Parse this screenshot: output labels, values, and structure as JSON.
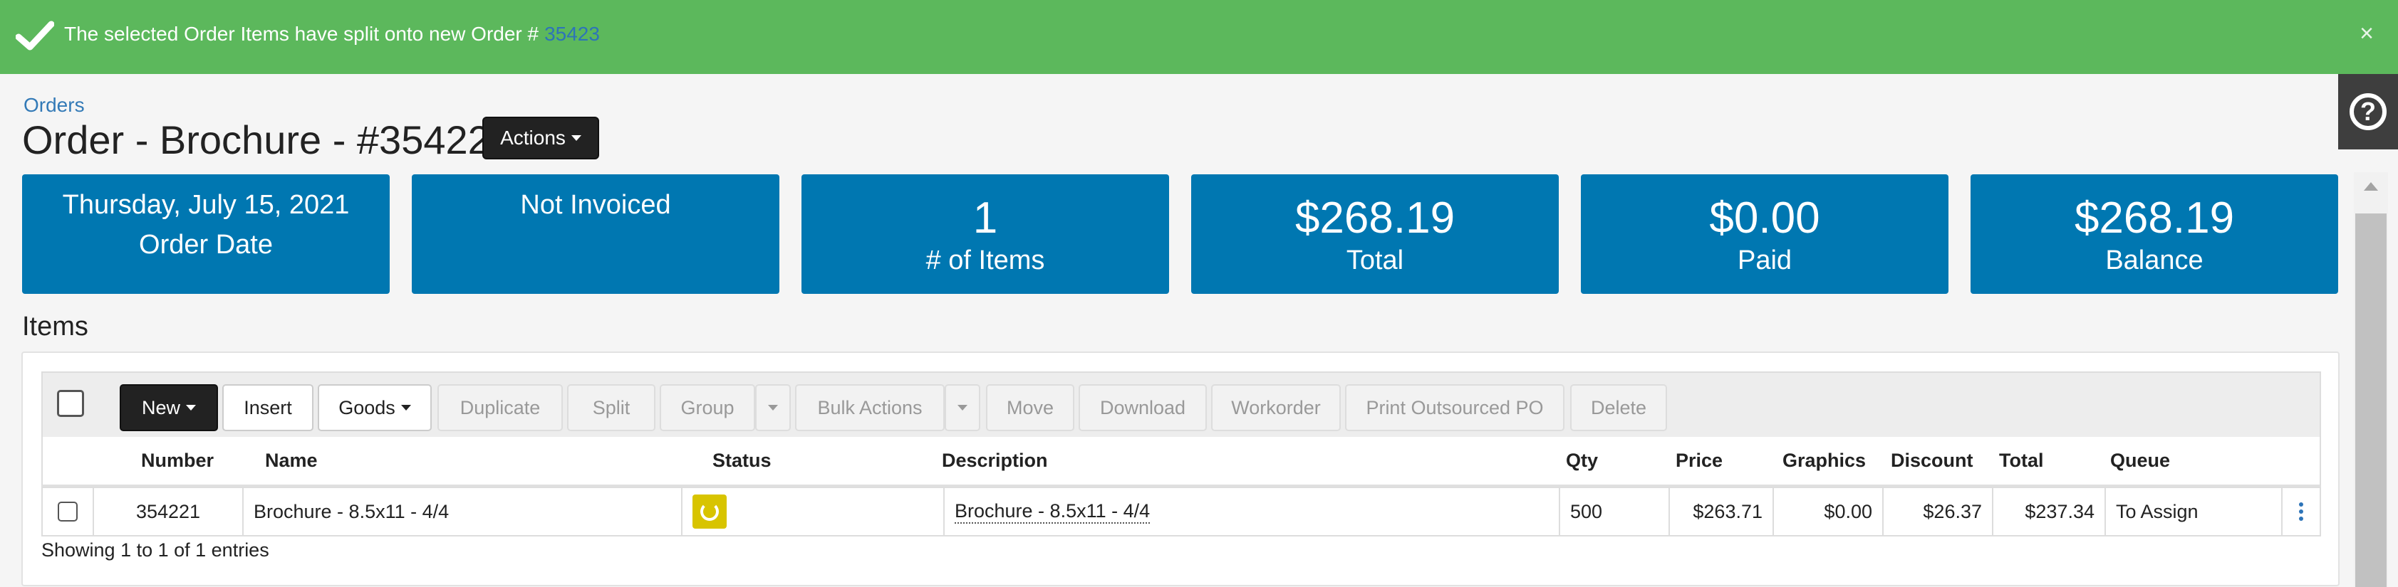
{
  "alert": {
    "message": "The selected Order Items have split onto new Order #",
    "order_link": "35423",
    "close": "×"
  },
  "help": {
    "label": "?"
  },
  "breadcrumb": "Orders",
  "title": "Order - Brochure - #35422",
  "actions_label": "Actions",
  "cards": [
    {
      "line1": "Thursday, July 15, 2021",
      "line2": "Order Date"
    },
    {
      "line1": "Not Invoiced",
      "line2": ""
    },
    {
      "line1": "1",
      "line2": "# of Items"
    },
    {
      "line1": "$268.19",
      "line2": "Total"
    },
    {
      "line1": "$0.00",
      "line2": "Paid"
    },
    {
      "line1": "$268.19",
      "line2": "Balance"
    }
  ],
  "items_heading": "Items",
  "toolbar": {
    "new": "New",
    "insert": "Insert",
    "goods": "Goods",
    "duplicate": "Duplicate",
    "split": "Split",
    "group": "Group",
    "bulk_actions": "Bulk Actions",
    "move": "Move",
    "download": "Download",
    "workorder": "Workorder",
    "print_po": "Print Outsourced PO",
    "delete": "Delete"
  },
  "columns": {
    "number": "Number",
    "name": "Name",
    "status": "Status",
    "description": "Description",
    "qty": "Qty",
    "price": "Price",
    "graphics": "Graphics",
    "discount": "Discount",
    "total": "Total",
    "queue": "Queue"
  },
  "rows": [
    {
      "number": "354221",
      "name": "Brochure - 8.5x11 - 4/4",
      "description": "Brochure - 8.5x11 - 4/4",
      "qty": "500",
      "price": "$263.71",
      "graphics": "$0.00",
      "discount": "$26.37",
      "total": "$237.34",
      "queue": "To Assign"
    }
  ],
  "footer": "Showing 1 to 1 of 1 entries",
  "colors": {
    "alert_bg": "#5cb85c",
    "card_bg": "#0077b1",
    "link": "#2d74b8",
    "status": "#d8c400"
  }
}
